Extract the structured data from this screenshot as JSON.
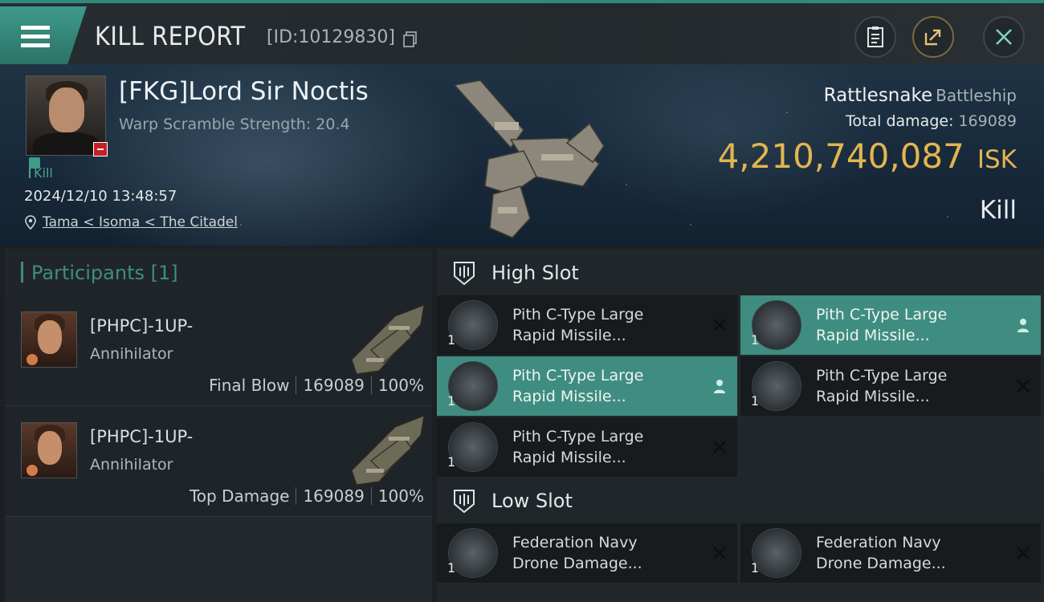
{
  "header": {
    "title": "KILL REPORT",
    "report_id": "[ID:10129830]"
  },
  "victim": {
    "name": "[FKG]Lord Sir Noctis",
    "warp_scramble": "Warp Scramble Strength: 20.4",
    "tag": "Kill",
    "datetime": "2024/12/10 13:48:57",
    "location": "Tama < Isoma < The Citadel",
    "ship_name": "Rattlesnake",
    "ship_class": "Battleship",
    "total_damage_label": "Total damage:",
    "total_damage": "169089",
    "isk_value": "4,210,740,087",
    "isk_unit": "ISK",
    "result": "Kill"
  },
  "participants": {
    "title": "Participants [1]",
    "rows": [
      {
        "name": "[PHPC]-1UP-",
        "ship": "Annihilator",
        "role": "Final Blow",
        "damage": "169089",
        "percent": "100%"
      },
      {
        "name": "[PHPC]-1UP-",
        "ship": "Annihilator",
        "role": "Top Damage",
        "damage": "169089",
        "percent": "100%"
      }
    ]
  },
  "high_slot": {
    "title": "High Slot",
    "modules": [
      {
        "line1": "Pith C-Type Large",
        "line2": "Rapid Missile...",
        "qty": "1",
        "status": "destroyed"
      },
      {
        "line1": "Pith C-Type Large",
        "line2": "Rapid Missile...",
        "qty": "1",
        "status": "dropped"
      },
      {
        "line1": "Pith C-Type Large",
        "line2": "Rapid Missile...",
        "qty": "1",
        "status": "dropped"
      },
      {
        "line1": "Pith C-Type Large",
        "line2": "Rapid Missile...",
        "qty": "1",
        "status": "destroyed"
      },
      {
        "line1": "Pith C-Type Large",
        "line2": "Rapid Missile...",
        "qty": "1",
        "status": "destroyed"
      }
    ]
  },
  "low_slot": {
    "title": "Low Slot",
    "modules": [
      {
        "line1": "Federation Navy",
        "line2": "Drone Damage...",
        "qty": "1",
        "status": "destroyed"
      },
      {
        "line1": "Federation Navy",
        "line2": "Drone Damage...",
        "qty": "1",
        "status": "destroyed"
      }
    ]
  },
  "icons": {
    "menu": "hamburger-icon",
    "copy": "copy-icon",
    "clipboard": "clipboard-icon",
    "share": "share-icon",
    "close": "close-icon",
    "location": "location-pin-icon",
    "destroyed": "x-icon",
    "dropped": "person-icon",
    "slot": "slot-icon"
  },
  "colors": {
    "accent": "#3f8d80",
    "isk": "#e2b54f",
    "danger": "#c4202a"
  }
}
